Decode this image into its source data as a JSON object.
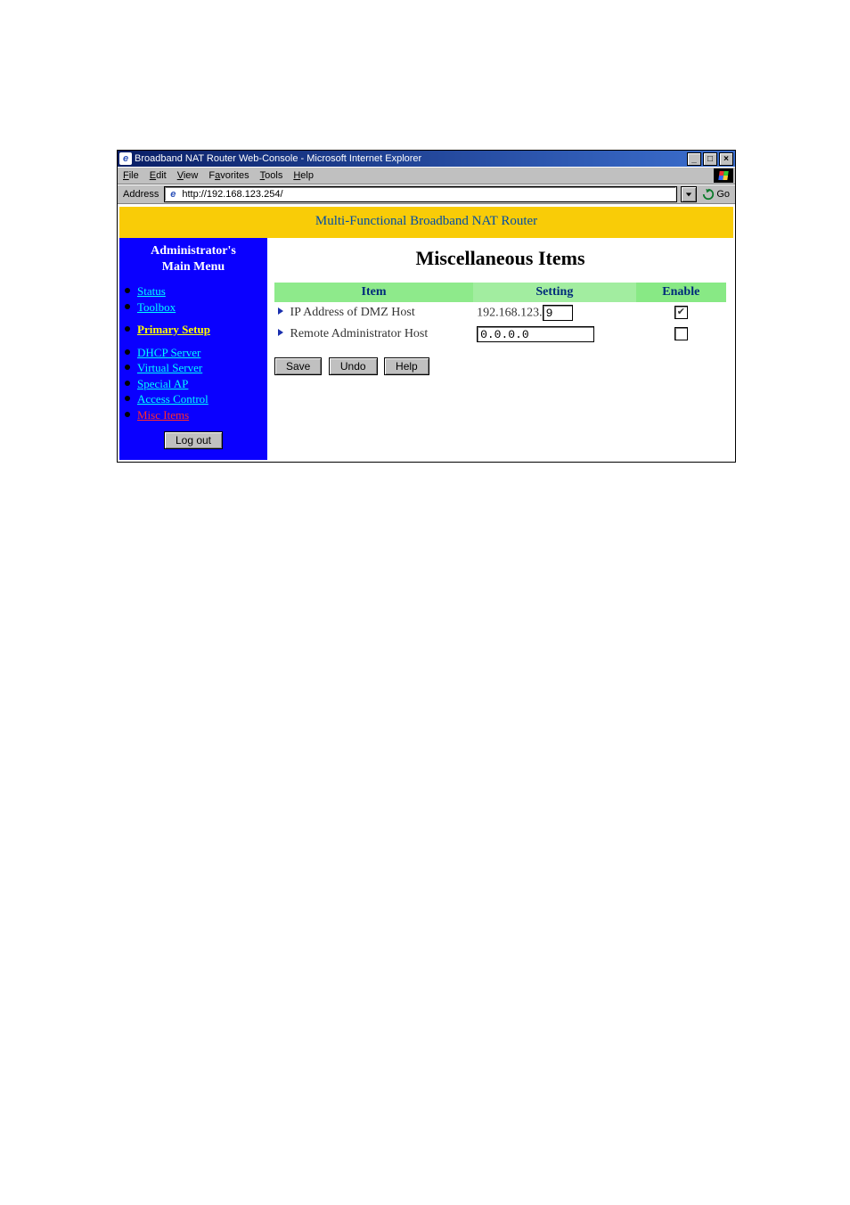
{
  "window": {
    "title": "Broadband NAT Router Web-Console - Microsoft Internet Explorer"
  },
  "menubar": {
    "file": "File",
    "edit": "Edit",
    "view": "View",
    "favorites": "Favorites",
    "tools": "Tools",
    "help": "Help"
  },
  "addressbar": {
    "label": "Address",
    "value": "http://192.168.123.254/",
    "go_label": "Go"
  },
  "banner": {
    "text": "Multi-Functional Broadband NAT Router"
  },
  "sidebar": {
    "heading_line1": "Administrator's",
    "heading_line2": "Main Menu",
    "group1": [
      {
        "label": "Status"
      },
      {
        "label": "Toolbox"
      }
    ],
    "group2": [
      {
        "label": "Primary Setup"
      }
    ],
    "group3": [
      {
        "label": "DHCP Server"
      },
      {
        "label": "Virtual Server"
      },
      {
        "label": "Special AP"
      },
      {
        "label": "Access Control"
      },
      {
        "label": "Misc Items"
      }
    ],
    "logout_label": "Log out"
  },
  "main": {
    "title": "Miscellaneous Items",
    "headers": {
      "item": "Item",
      "setting": "Setting",
      "enable": "Enable"
    },
    "rows": [
      {
        "name": "dmz-host",
        "label": "IP Address of DMZ Host",
        "ip_prefix": "192.168.123.",
        "ip_value": "9",
        "enabled": true,
        "check_glyph": "✔"
      },
      {
        "name": "remote-admin",
        "label": "Remote Administrator Host",
        "ip_value": "0.0.0.0",
        "enabled": false,
        "check_glyph": ""
      }
    ],
    "buttons": {
      "save": "Save",
      "undo": "Undo",
      "help": "Help"
    }
  }
}
